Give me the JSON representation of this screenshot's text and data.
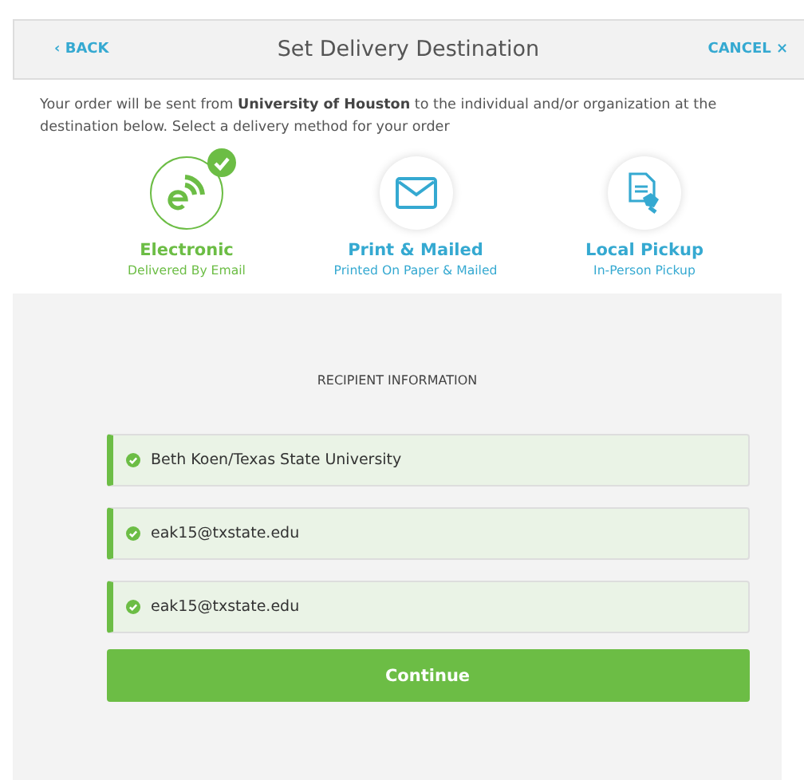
{
  "header": {
    "back": "‹ BACK",
    "title": "Set Delivery Destination",
    "cancel": "CANCEL ×"
  },
  "intro": "Your order will be sent from **University of Houston** to the individual and/or organization at the destination below. Select a delivery method for your order",
  "methods": [
    {
      "kind": "electronic",
      "label": "Electronic",
      "sublabel": "Delivered By Email",
      "selected": true
    },
    {
      "kind": "mail",
      "label": "Print & Mailed",
      "sublabel": "Printed On Paper & Mailed",
      "selected": false
    },
    {
      "kind": "pickup",
      "label": "Local Pickup",
      "sublabel": "In-Person Pickup",
      "selected": false
    }
  ],
  "section_title": "RECIPIENT INFORMATION",
  "fields": [
    {
      "value": "Beth Koen/Texas State University",
      "valid": true
    },
    {
      "value": "eak15@txstate.edu",
      "valid": true
    },
    {
      "value": "eak15@txstate.edu",
      "valid": true
    }
  ],
  "continue_button": "Continue"
}
